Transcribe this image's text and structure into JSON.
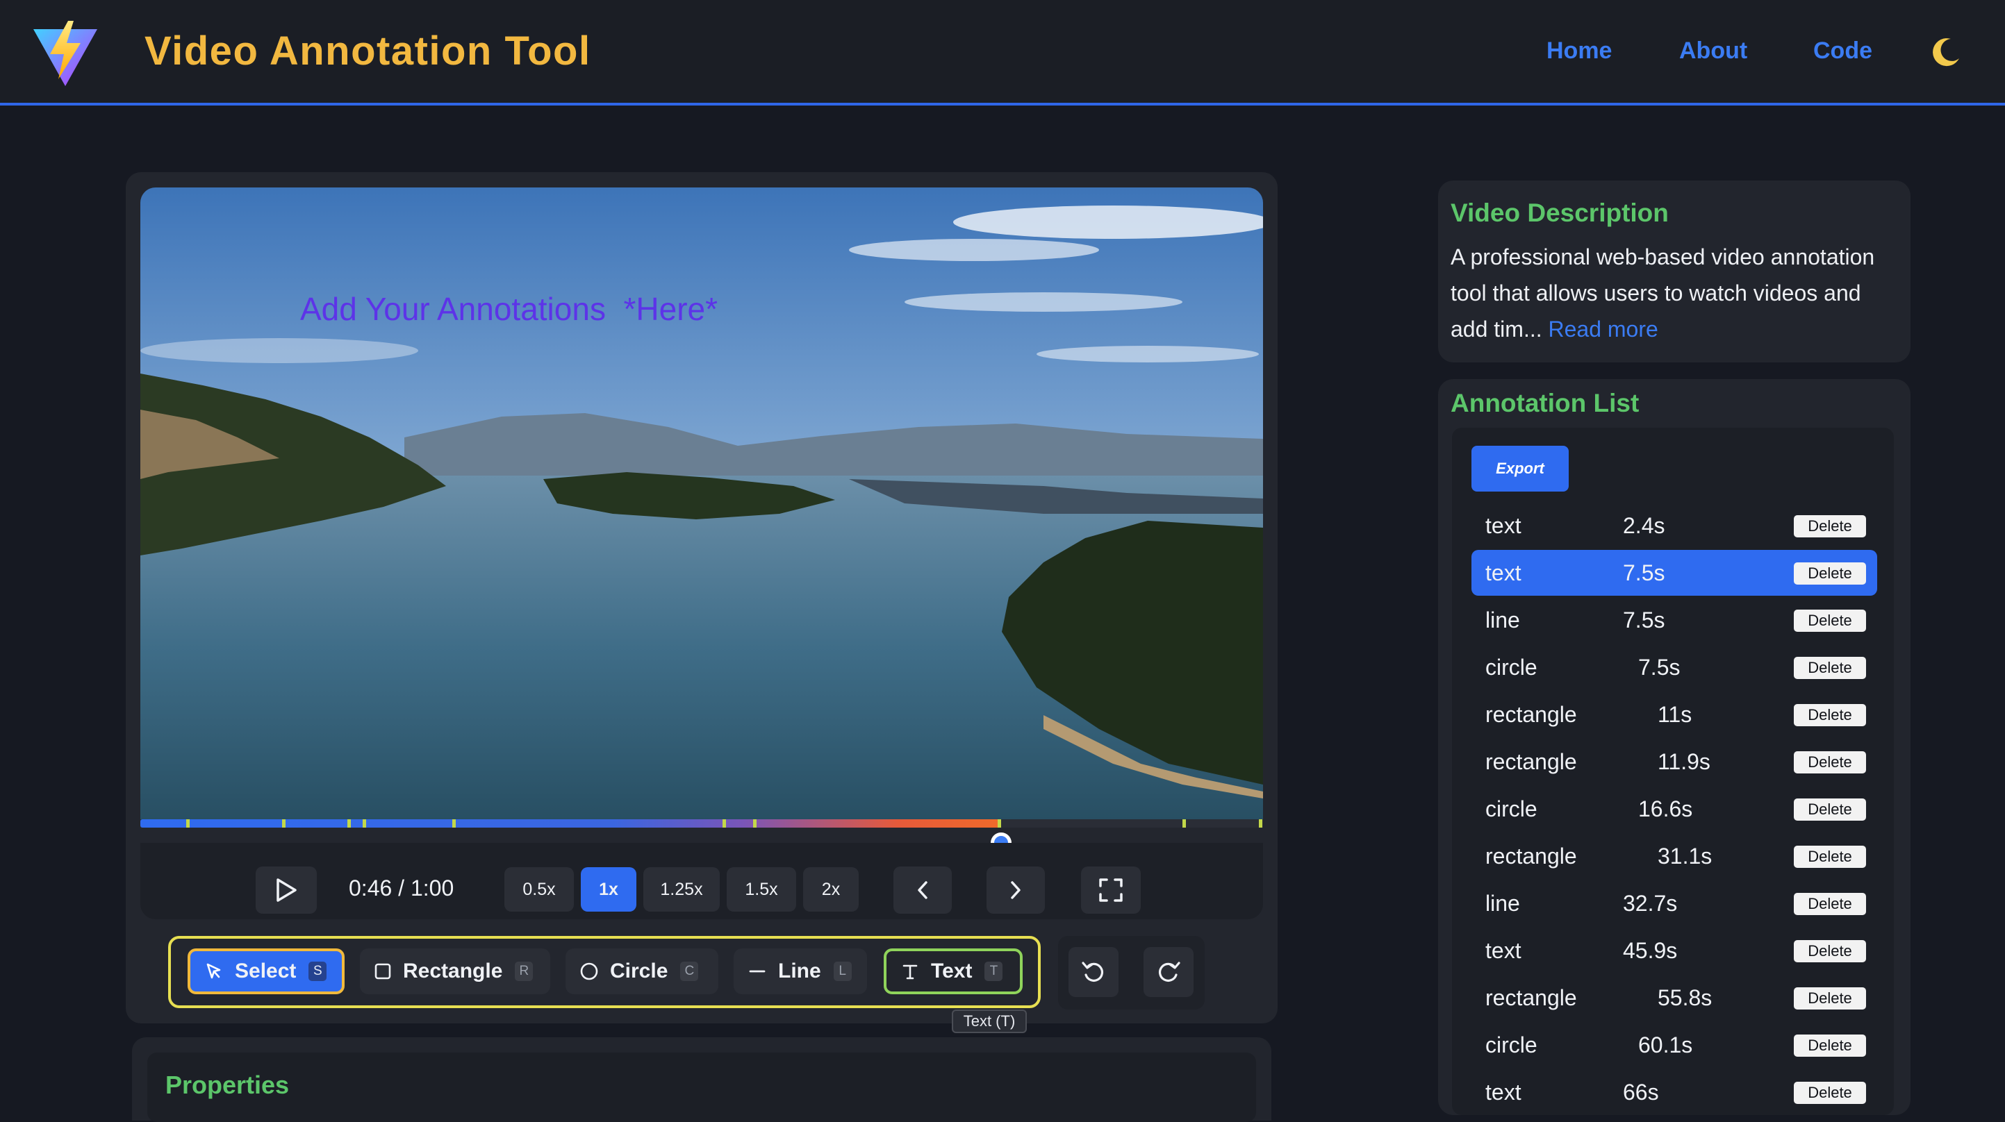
{
  "header": {
    "title": "Video Annotation Tool",
    "nav": [
      "Home",
      "About",
      "Code"
    ],
    "logo_icon": "vite-bolt-logo-icon",
    "theme_icon": "moon-icon",
    "accent_color": "#2f66e8",
    "title_color": "#f2b840"
  },
  "player": {
    "overlay_annotation": "Add Your Annotations  *Here*",
    "time_display": "0:46 / 1:00",
    "progress_fraction": 0.767,
    "speeds": [
      "0.5x",
      "1x",
      "1.25x",
      "1.5x",
      "2x"
    ],
    "active_speed": "1x",
    "icons": [
      "play-icon",
      "chevron-left-icon",
      "chevron-right-icon",
      "fullscreen-icon"
    ]
  },
  "tools": {
    "items": [
      {
        "label": "Select",
        "key": "S",
        "icon": "cursor-icon"
      },
      {
        "label": "Rectangle",
        "key": "R",
        "icon": "square-icon"
      },
      {
        "label": "Circle",
        "key": "C",
        "icon": "circle-icon"
      },
      {
        "label": "Line",
        "key": "L",
        "icon": "line-icon"
      },
      {
        "label": "Text",
        "key": "T",
        "icon": "text-icon"
      }
    ],
    "selected": "Select",
    "tooltip": "Text (T)",
    "history_icons": [
      "undo-icon",
      "redo-icon"
    ]
  },
  "properties": {
    "title": "Properties"
  },
  "description": {
    "title": "Video Description",
    "text": "A professional web-based video annotation tool that allows users to watch videos and add tim...",
    "read_more": "Read more"
  },
  "annotations": {
    "title": "Annotation List",
    "export_label": "Export",
    "delete_label": "Delete",
    "active_index": 1,
    "rows": [
      {
        "type": "text",
        "time": "2.4s"
      },
      {
        "type": "text",
        "time": "7.5s"
      },
      {
        "type": "line",
        "time": "7.5s"
      },
      {
        "type": "circle",
        "time": "7.5s"
      },
      {
        "type": "rectangle",
        "time": "11s"
      },
      {
        "type": "rectangle",
        "time": "11.9s"
      },
      {
        "type": "circle",
        "time": "16.6s"
      },
      {
        "type": "rectangle",
        "time": "31.1s"
      },
      {
        "type": "line",
        "time": "32.7s"
      },
      {
        "type": "text",
        "time": "45.9s"
      },
      {
        "type": "rectangle",
        "time": "55.8s"
      },
      {
        "type": "circle",
        "time": "60.1s"
      },
      {
        "type": "text",
        "time": "66s"
      }
    ]
  }
}
